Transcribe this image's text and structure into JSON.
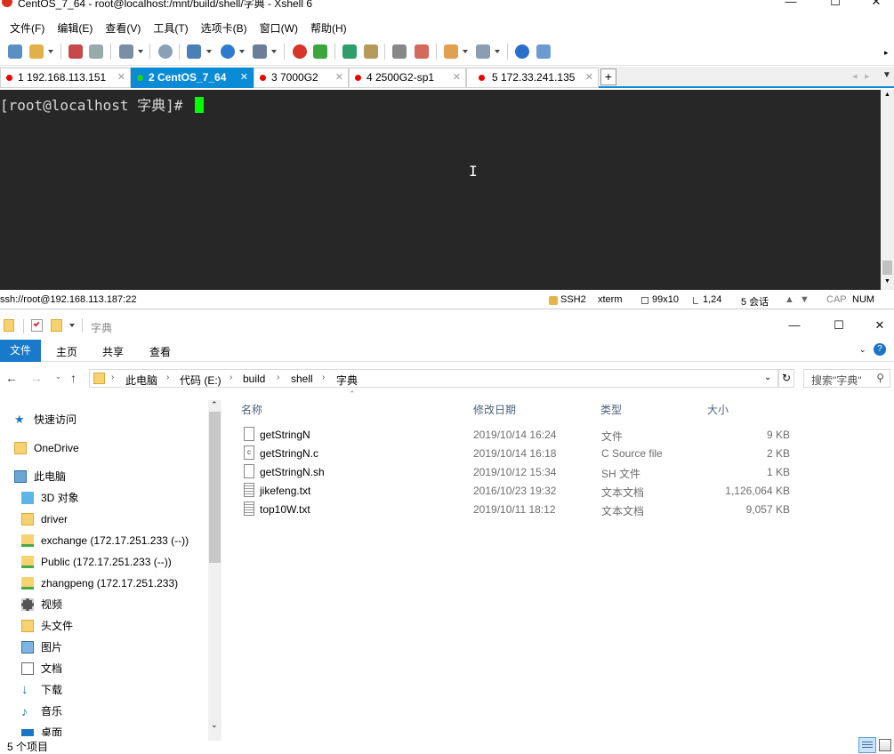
{
  "xshell": {
    "title": "CentOS_7_64 - root@localhost:/mnt/build/shell/字典 - Xshell 6",
    "window_buttons": [
      "—",
      "☐",
      "✕"
    ],
    "menu": [
      "文件(F)",
      "编辑(E)",
      "查看(V)",
      "工具(T)",
      "选项卡(B)",
      "窗口(W)",
      "帮助(H)"
    ],
    "tabs": [
      {
        "label": "1 192.168.113.151",
        "active": false
      },
      {
        "label": "2 CentOS_7_64",
        "active": true
      },
      {
        "label": "3 7000G2",
        "active": false
      },
      {
        "label": "4 2500G2-sp1",
        "active": false
      },
      {
        "label": "5 172.33.241.135",
        "active": false
      }
    ],
    "tab_add": "+",
    "terminal": {
      "prompt": "[root@localhost 字典]# "
    },
    "status": {
      "connection": "ssh://root@192.168.113.187:22",
      "protocol": "SSH2",
      "term_type": "xterm",
      "size": "99x10",
      "position": "1,24",
      "sessions": "5 会话",
      "cap": "CAP",
      "num": "NUM"
    }
  },
  "explorer": {
    "title": "字典",
    "window_buttons": [
      "—",
      "☐",
      "✕"
    ],
    "ribbon_tabs": [
      "文件",
      "主页",
      "共享",
      "查看"
    ],
    "breadcrumb": [
      "此电脑",
      "代码 (E:)",
      "build",
      "shell",
      "字典"
    ],
    "search_placeholder": "搜索\"字典\"",
    "nav_items": [
      "快速访问",
      "OneDrive",
      "此电脑",
      "3D 对象",
      "driver",
      "exchange (172.17.251.233 (--))",
      "Public (172.17.251.233 (--))",
      "zhangpeng (172.17.251.233)",
      "视频",
      "头文件",
      "图片",
      "文档",
      "下载",
      "音乐",
      "桌面"
    ],
    "columns": [
      "名称",
      "修改日期",
      "类型",
      "大小"
    ],
    "files": [
      {
        "name": "getStringN",
        "date": "2019/10/14 16:24",
        "type": "文件",
        "size": "9 KB"
      },
      {
        "name": "getStringN.c",
        "date": "2019/10/14 16:18",
        "type": "C Source file",
        "size": "2 KB"
      },
      {
        "name": "getStringN.sh",
        "date": "2019/10/12 15:34",
        "type": "SH 文件",
        "size": "1 KB"
      },
      {
        "name": "jikefeng.txt",
        "date": "2016/10/23 19:32",
        "type": "文本文档",
        "size": "1,126,064 KB"
      },
      {
        "name": "top10W.txt",
        "date": "2019/10/11 18:12",
        "type": "文本文档",
        "size": "9,057 KB"
      }
    ],
    "status": "5 个项目"
  }
}
